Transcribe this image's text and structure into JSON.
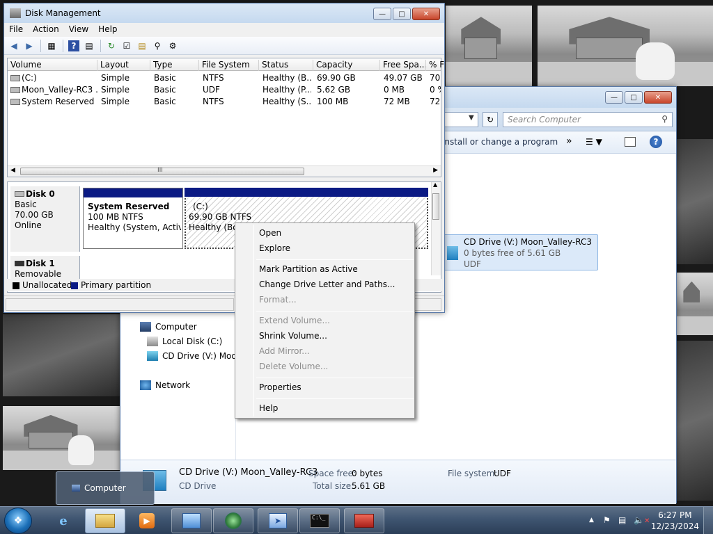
{
  "disk_management": {
    "title": "Disk Management",
    "menu": [
      "File",
      "Action",
      "View",
      "Help"
    ],
    "columns": [
      "Volume",
      "Layout",
      "Type",
      "File System",
      "Status",
      "Capacity",
      "Free Spa...",
      "% F"
    ],
    "rows": [
      {
        "volume": "(C:)",
        "layout": "Simple",
        "type": "Basic",
        "fs": "NTFS",
        "status": "Healthy (B...",
        "capacity": "69.90 GB",
        "free": "49.07 GB",
        "pct": "70"
      },
      {
        "volume": "Moon_Valley-RC3 ...",
        "layout": "Simple",
        "type": "Basic",
        "fs": "UDF",
        "status": "Healthy (P...",
        "capacity": "5.62 GB",
        "free": "0 MB",
        "pct": "0 %"
      },
      {
        "volume": "System Reserved",
        "layout": "Simple",
        "type": "Basic",
        "fs": "NTFS",
        "status": "Healthy (S...",
        "capacity": "100 MB",
        "free": "72 MB",
        "pct": "72"
      }
    ],
    "scroll_grip": "III",
    "disk0": {
      "name": "Disk 0",
      "type": "Basic",
      "size": "70.00 GB",
      "state": "Online"
    },
    "disk0_parts": [
      {
        "title": "System Reserved",
        "line2": "100 MB NTFS",
        "line3": "Healthy (System, Active,"
      },
      {
        "title": "(C:)",
        "line2": "69.90 GB NTFS",
        "line3": "Healthy (Boot"
      }
    ],
    "disk1": {
      "name": "Disk 1",
      "type": "Removable (E:)"
    },
    "legend": {
      "unallocated": "Unallocated",
      "primary": "Primary partition"
    },
    "colors": {
      "primary": "#0b1a84",
      "unallocated": "#000000"
    }
  },
  "context_menu": {
    "items": [
      {
        "label": "Open",
        "enabled": true
      },
      {
        "label": "Explore",
        "enabled": true
      },
      {
        "label": "Mark Partition as Active",
        "enabled": true
      },
      {
        "label": "Change Drive Letter and Paths...",
        "enabled": true
      },
      {
        "label": "Format...",
        "enabled": false
      },
      {
        "label": "Extend Volume...",
        "enabled": false
      },
      {
        "label": "Shrink Volume...",
        "enabled": true
      },
      {
        "label": "Add Mirror...",
        "enabled": false
      },
      {
        "label": "Delete Volume...",
        "enabled": false
      },
      {
        "label": "Properties",
        "enabled": true
      },
      {
        "label": "Help",
        "enabled": true
      }
    ]
  },
  "explorer": {
    "search_placeholder": "Search Computer",
    "command_text": "install or change a program",
    "more_glyph": "»",
    "nav": {
      "computer": "Computer",
      "local_disk": "Local Disk (C:)",
      "cd_drive": "CD Drive (V:) Moon_",
      "network": "Network"
    },
    "cd_tile": {
      "name": "CD Drive (V:) Moon_Valley-RC3",
      "free": "0 bytes free of 5.61 GB",
      "fs": "UDF"
    },
    "details": {
      "name": "CD Drive (V:) Moon_Valley-RC3",
      "kind": "CD Drive",
      "space_free_label": "Space free:",
      "space_free": "0 bytes",
      "total_size_label": "Total size:",
      "total_size": "5.61 GB",
      "fs_label": "File system:",
      "fs": "UDF"
    }
  },
  "thumbnail_popup": {
    "label": "Computer"
  },
  "taskbar": {
    "time": "6:27 PM",
    "date": "12/23/2024"
  }
}
